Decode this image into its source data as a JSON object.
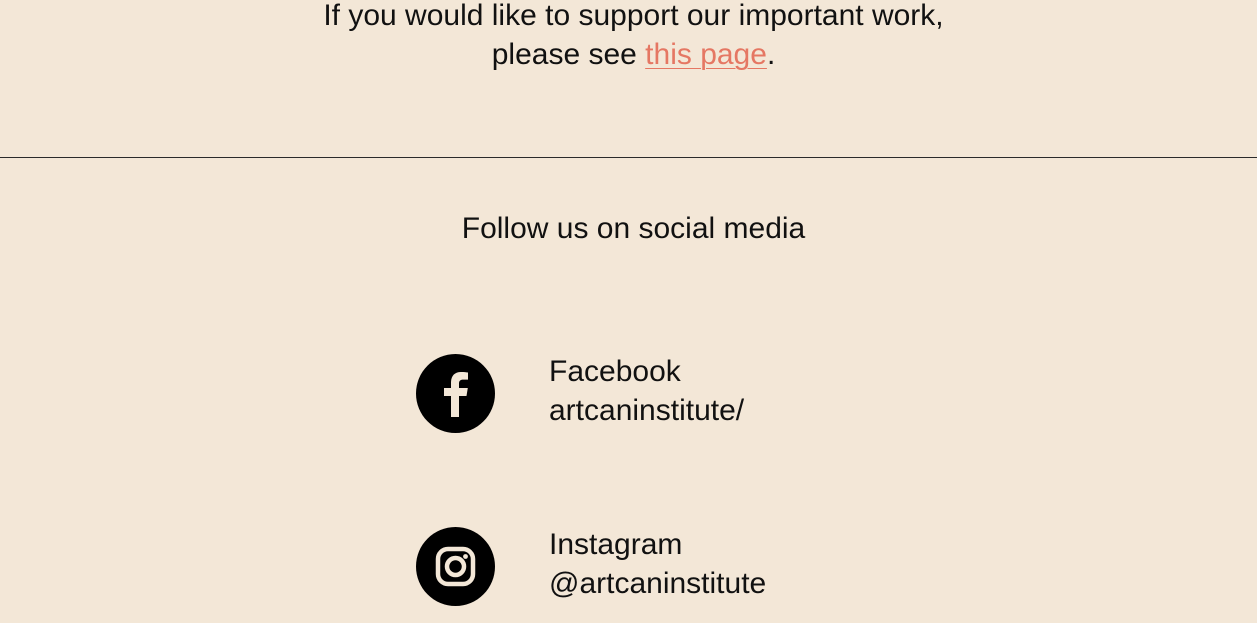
{
  "support": {
    "line1": "If you would like to support our important work,",
    "line2_prefix": "please see ",
    "link_text": "this page",
    "line2_suffix": "."
  },
  "social": {
    "heading": "Follow us on social media",
    "items": [
      {
        "icon": "facebook-icon",
        "name": "Facebook",
        "handle": "artcaninstitute/"
      },
      {
        "icon": "instagram-icon",
        "name": "Instagram",
        "handle": "@artcaninstitute"
      }
    ]
  },
  "colors": {
    "background": "#f3e7d7",
    "link": "#e57763",
    "text": "#111111",
    "icon_bg": "#000000"
  }
}
